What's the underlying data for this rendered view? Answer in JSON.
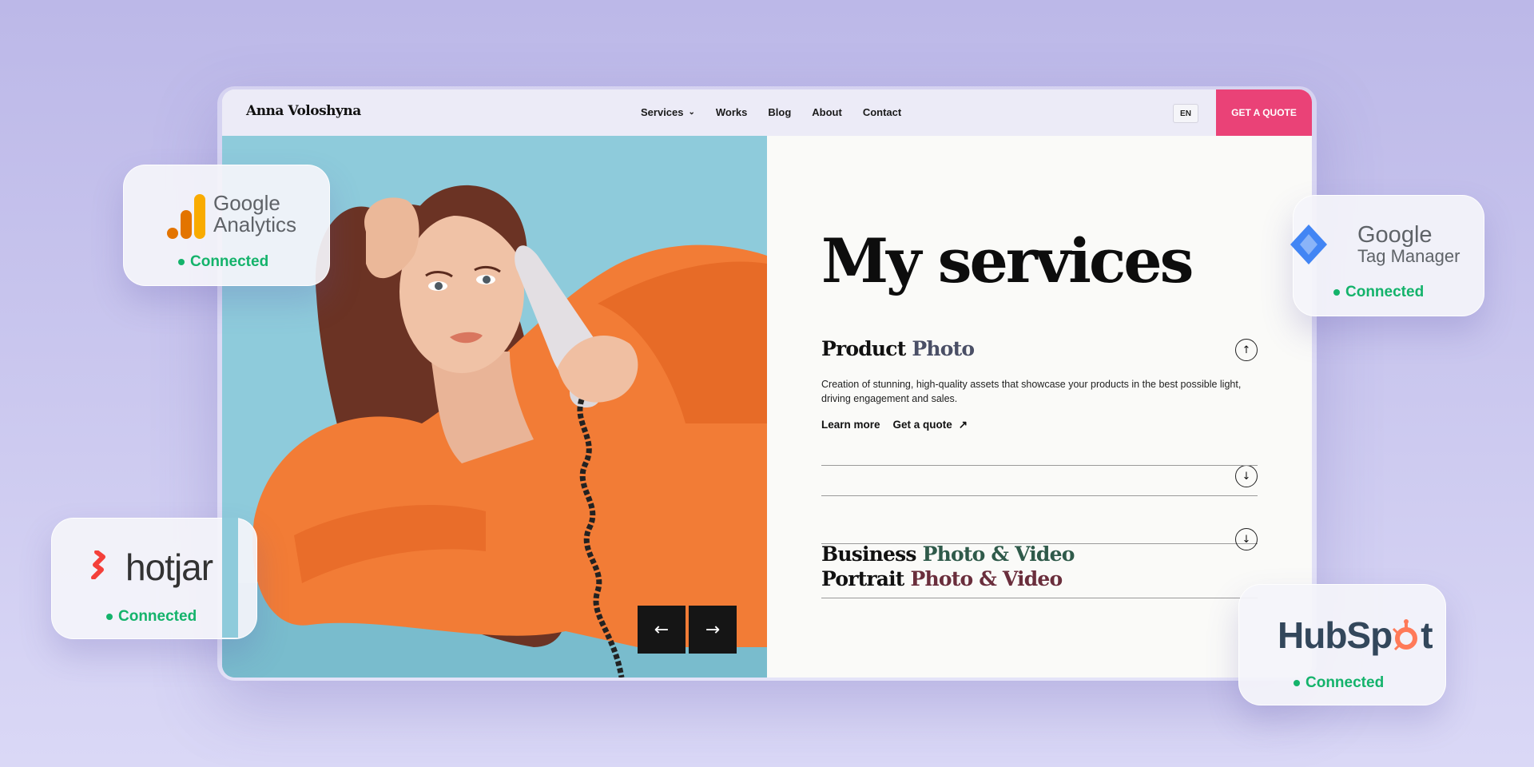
{
  "site": {
    "brand": "Anna Voloshyna",
    "nav": [
      {
        "label": "Services",
        "has_dropdown": true
      },
      {
        "label": "Works"
      },
      {
        "label": "Blog"
      },
      {
        "label": "About"
      },
      {
        "label": "Contact"
      }
    ],
    "language": "EN",
    "cta_label": "GET A QUOTE",
    "accent_color": "#ea4277"
  },
  "hero": {
    "prev_icon": "arrow-left-icon",
    "next_icon": "arrow-right-icon"
  },
  "services": {
    "title": "My services",
    "items": [
      {
        "title_word1": "Product",
        "title_rest": " Photo",
        "title_color": "#4a4f66",
        "expanded": true,
        "description": "Creation of stunning, high-quality assets that showcase your products in the best possible light, driving engagement and sales.",
        "learn_more": "Learn more",
        "get_quote": "Get a quote"
      },
      {
        "title_word1": "Business",
        "title_rest": " Photo & Video",
        "title_color": "#2f5a4a",
        "expanded": false
      },
      {
        "title_word1": "Portrait",
        "title_rest": " Photo & Video",
        "title_color": "#6a2e3c",
        "expanded": false
      }
    ]
  },
  "integrations": {
    "google_analytics": {
      "line1": "Google",
      "line2": "Analytics",
      "status": "Connected"
    },
    "google_tag_manager": {
      "line1": "Google",
      "line2": "Tag Manager",
      "status": "Connected"
    },
    "hotjar": {
      "name": "hotjar",
      "status": "Connected"
    },
    "hubspot": {
      "name_part1": "HubSp",
      "name_part2": "t",
      "status": "Connected"
    },
    "status_color": "#14b36b"
  }
}
